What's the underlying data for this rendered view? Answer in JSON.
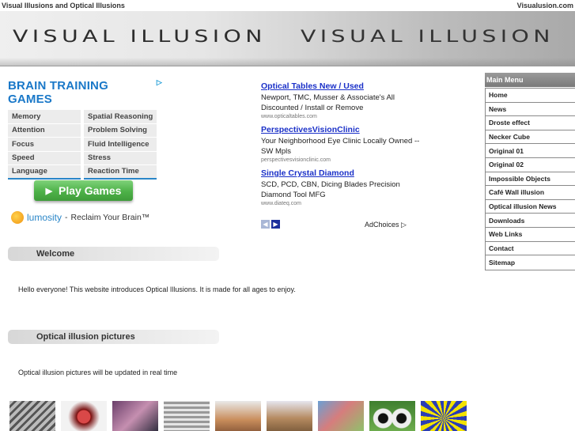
{
  "topbar": {
    "site_title": "Visual Illusions and Optical Illusions",
    "domain": "Visualusion.com"
  },
  "banner": {
    "text_left": "VISUAL ILLUSION",
    "text_right": "VISUAL ILLUSION"
  },
  "brain_ad": {
    "title": "BRAIN TRAINING GAMES",
    "categories": [
      [
        "Memory",
        "Spatial Reasoning"
      ],
      [
        "Attention",
        "Problem Solving"
      ],
      [
        "Focus",
        "Fluid Intelligence"
      ],
      [
        "Speed",
        "Stress"
      ],
      [
        "Language",
        "Reaction Time"
      ]
    ],
    "play_label": "Play Games",
    "brand": "lumosity",
    "tagline": "Reclaim Your Brain™"
  },
  "text_ads": [
    {
      "title": "Optical Tables New / Used",
      "desc": "Newport, TMC, Musser & Associate's All Discounted / Install or Remove",
      "url": "www.opticaltables.com"
    },
    {
      "title": "PerspectivesVisionClinic",
      "desc": "Your Neighborhood Eye Clinic Locally Owned -- SW Mpls",
      "url": "perspectivesvisionclinic.com"
    },
    {
      "title": "Single Crystal Diamond",
      "desc": "SCD, PCD, CBN, Dicing Blades Precision Diamond Tool MFG",
      "url": "www.diateq.com"
    }
  ],
  "adchoices": "AdChoices",
  "sections": {
    "welcome_title": "Welcome",
    "welcome_text": "Hello everyone! This website introduces Optical Illusions. It is made for all ages to enjoy.",
    "pictures_title": "Optical illusion pictures",
    "pictures_text": "Optical illusion pictures will be updated in real time"
  },
  "menu": {
    "header": "Main Menu",
    "items": [
      "Home",
      "News",
      "Droste effect",
      "Necker Cube",
      "Original 01",
      "Original 02",
      "Impossible Objects",
      "Café Wall illusion",
      "Optical illusion News",
      "Downloads",
      "Web Links",
      "Contact",
      "Sitemap"
    ]
  }
}
